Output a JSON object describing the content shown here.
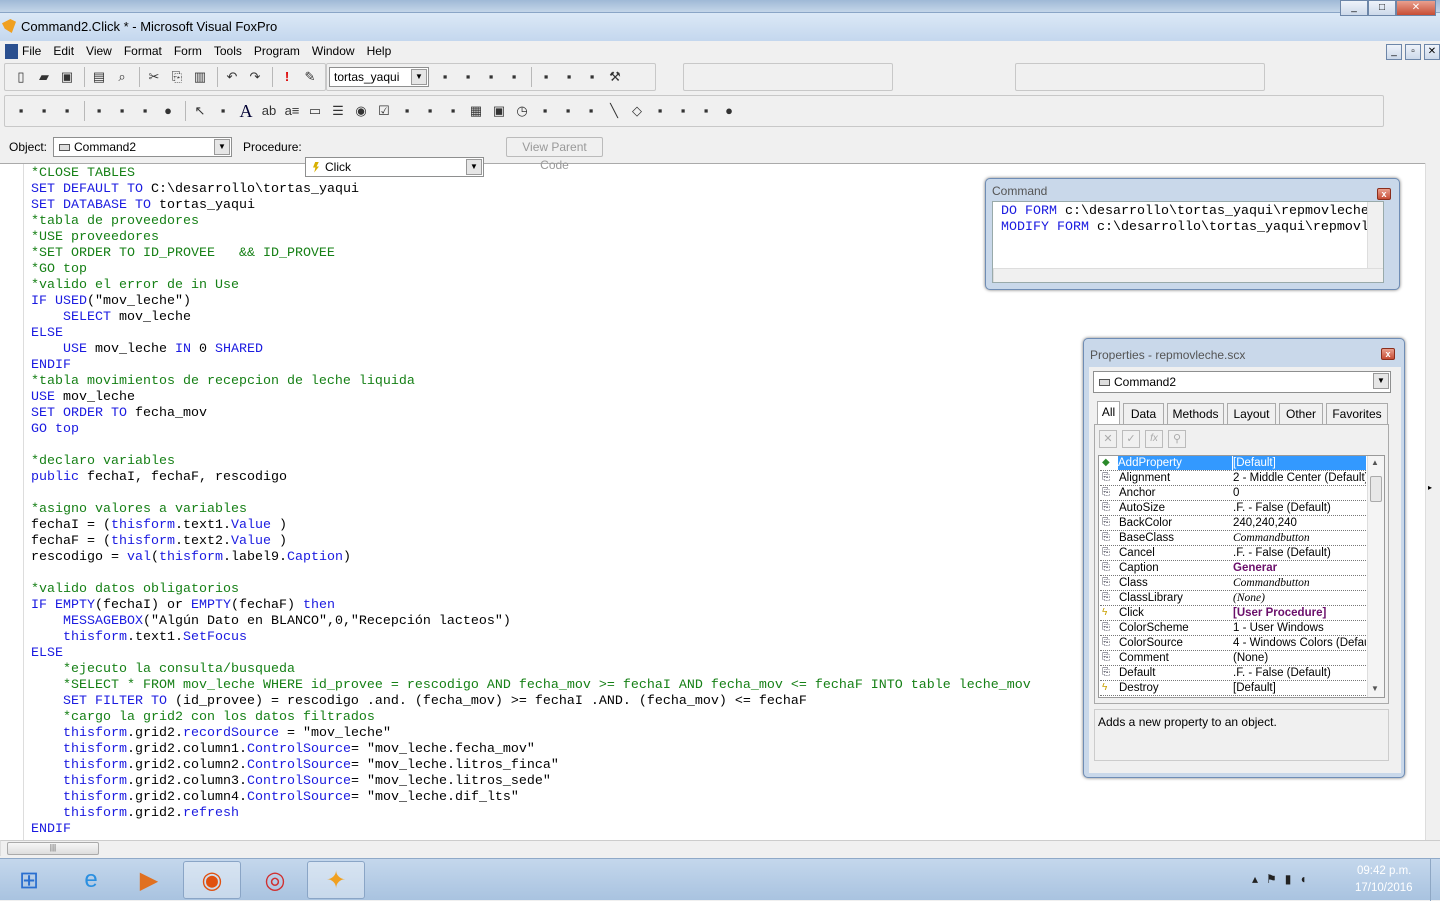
{
  "window": {
    "title": "Command2.Click * - Microsoft Visual FoxPro",
    "controls": [
      "_",
      "□",
      "✕"
    ],
    "mdi_controls": [
      "_",
      "▫",
      "✕"
    ]
  },
  "menu": [
    "File",
    "Edit",
    "View",
    "Format",
    "Form",
    "Tools",
    "Program",
    "Window",
    "Help"
  ],
  "toolbar": {
    "database_combo": "tortas_yaqui",
    "row1_icons": [
      "new-icon",
      "open-icon",
      "save-icon",
      "|",
      "print-icon",
      "print-preview-icon",
      "|",
      "cut-icon",
      "copy-icon",
      "paste-icon",
      "|",
      "undo-icon",
      "redo-icon",
      "|",
      "run-icon",
      "modify-form-icon"
    ],
    "row1b_icons": [
      "data-session-icon",
      "database-icon",
      "properties-icon",
      "code-window-icon",
      "|",
      "form-builder-icon",
      "autoformat-icon",
      "tab-order-icon",
      "tools-icon"
    ],
    "row2_icons": [
      "builder-lock-icon",
      "layout-icon",
      "grid-icon",
      "|",
      "builder-icon",
      "autoformat2-icon",
      "align-icon",
      "lock-icon",
      "|",
      "pointer-icon",
      "view-classes-icon",
      "label-icon",
      "textbox-icon",
      "editbox-icon",
      "commandbutton-icon",
      "commandgroup-icon",
      "optiongroup-icon",
      "checkbox-icon",
      "combobox-icon",
      "listbox-icon",
      "spinner-icon",
      "grid-control-icon",
      "image-icon",
      "timer-icon",
      "pageframe-icon",
      "ole-container-icon",
      "ole-bound-icon",
      "line-icon",
      "shape-icon",
      "container-icon",
      "separator-icon",
      "hyperlink-icon",
      "button-lock-icon"
    ]
  },
  "object_bar": {
    "object_label": "Object:",
    "object_value": "Command2",
    "procedure_label": "Procedure:",
    "procedure_value": "Click",
    "view_parent_label": "View Parent Code"
  },
  "code_lines": [
    [
      [
        "c",
        "*CLOSE TABLES"
      ]
    ],
    [
      [
        "k",
        "SET DEFAULT TO "
      ],
      [
        "x",
        "C:\\desarrollo\\tortas_yaqui"
      ]
    ],
    [
      [
        "k",
        "SET DATABASE TO "
      ],
      [
        "x",
        "tortas_yaqui"
      ]
    ],
    [
      [
        "c",
        "*tabla de proveedores"
      ]
    ],
    [
      [
        "c",
        "*USE proveedores"
      ]
    ],
    [
      [
        "c",
        "*SET ORDER TO ID_PROVEE   && ID_PROVEE"
      ]
    ],
    [
      [
        "c",
        "*GO top"
      ]
    ],
    [
      [
        "c",
        "*valido el error de in Use"
      ]
    ],
    [
      [
        "k",
        "IF USED"
      ],
      [
        "x",
        "(\"mov_leche\")"
      ]
    ],
    [
      [
        "k",
        "    SELECT "
      ],
      [
        "x",
        "mov_leche"
      ]
    ],
    [
      [
        "k",
        "ELSE"
      ]
    ],
    [
      [
        "k",
        "    USE "
      ],
      [
        "x",
        "mov_leche "
      ],
      [
        "k",
        "IN "
      ],
      [
        "x",
        "0 "
      ],
      [
        "k",
        "SHARED"
      ]
    ],
    [
      [
        "k",
        "ENDIF"
      ]
    ],
    [
      [
        "c",
        "*tabla movimientos de recepcion de leche liquida"
      ]
    ],
    [
      [
        "k",
        "USE "
      ],
      [
        "x",
        "mov_leche"
      ]
    ],
    [
      [
        "k",
        "SET ORDER TO "
      ],
      [
        "x",
        "fecha_mov"
      ]
    ],
    [
      [
        "k",
        "GO top"
      ]
    ],
    [],
    [
      [
        "c",
        "*declaro variables"
      ]
    ],
    [
      [
        "k",
        "public "
      ],
      [
        "x",
        "fechaI, fechaF, rescodigo"
      ]
    ],
    [],
    [
      [
        "c",
        "*asigno valores a variables"
      ]
    ],
    [
      [
        "x",
        "fechaI = ("
      ],
      [
        "k",
        "thisform"
      ],
      [
        "x",
        ".text1."
      ],
      [
        "k",
        "Value"
      ],
      [
        "x",
        " )"
      ]
    ],
    [
      [
        "x",
        "fechaF = ("
      ],
      [
        "k",
        "thisform"
      ],
      [
        "x",
        ".text2."
      ],
      [
        "k",
        "Value"
      ],
      [
        "x",
        " )"
      ]
    ],
    [
      [
        "x",
        "rescodigo = "
      ],
      [
        "k",
        "val"
      ],
      [
        "x",
        "("
      ],
      [
        "k",
        "thisform"
      ],
      [
        "x",
        ".label9."
      ],
      [
        "k",
        "Caption"
      ],
      [
        "x",
        ")"
      ]
    ],
    [],
    [
      [
        "c",
        "*valido datos obligatorios"
      ]
    ],
    [
      [
        "k",
        "IF EMPTY"
      ],
      [
        "x",
        "(fechaI) or "
      ],
      [
        "k",
        "EMPTY"
      ],
      [
        "x",
        "(fechaF) "
      ],
      [
        "k",
        "then"
      ]
    ],
    [
      [
        "k",
        "    MESSAGEBOX"
      ],
      [
        "x",
        "(\"Algún Dato en BLANCO\",0,\"Recepción lacteos\")"
      ]
    ],
    [
      [
        "x",
        "    "
      ],
      [
        "k",
        "thisform"
      ],
      [
        "x",
        ".text1."
      ],
      [
        "k",
        "SetFocus"
      ]
    ],
    [
      [
        "k",
        "ELSE"
      ]
    ],
    [
      [
        "c",
        "    *ejecuto la consulta/busqueda"
      ]
    ],
    [
      [
        "c",
        "    *SELECT * FROM mov_leche WHERE id_provee = rescodigo AND fecha_mov >= fechaI AND fecha_mov <= fechaF INTO table leche_mov"
      ]
    ],
    [
      [
        "k",
        "    SET FILTER TO "
      ],
      [
        "x",
        "(id_provee) = rescodigo .and. (fecha_mov) >= fechaI .AND. (fecha_mov) <= fechaF"
      ]
    ],
    [
      [
        "c",
        "    *cargo la grid2 con los datos filtrados"
      ]
    ],
    [
      [
        "x",
        "    "
      ],
      [
        "k",
        "thisform"
      ],
      [
        "x",
        ".grid2."
      ],
      [
        "k",
        "recordSource"
      ],
      [
        "x",
        " = \"mov_leche\""
      ]
    ],
    [
      [
        "x",
        "    "
      ],
      [
        "k",
        "thisform"
      ],
      [
        "x",
        ".grid2.column1."
      ],
      [
        "k",
        "ControlSource"
      ],
      [
        "x",
        "= \"mov_leche.fecha_mov\""
      ]
    ],
    [
      [
        "x",
        "    "
      ],
      [
        "k",
        "thisform"
      ],
      [
        "x",
        ".grid2.column2."
      ],
      [
        "k",
        "ControlSource"
      ],
      [
        "x",
        "= \"mov_leche.litros_finca\""
      ]
    ],
    [
      [
        "x",
        "    "
      ],
      [
        "k",
        "thisform"
      ],
      [
        "x",
        ".grid2.column3."
      ],
      [
        "k",
        "ControlSource"
      ],
      [
        "x",
        "= \"mov_leche.litros_sede\""
      ]
    ],
    [
      [
        "x",
        "    "
      ],
      [
        "k",
        "thisform"
      ],
      [
        "x",
        ".grid2.column4."
      ],
      [
        "k",
        "ControlSource"
      ],
      [
        "x",
        "= \"mov_leche.dif_lts\""
      ]
    ],
    [
      [
        "x",
        "    "
      ],
      [
        "k",
        "thisform"
      ],
      [
        "x",
        ".grid2."
      ],
      [
        "k",
        "refresh"
      ]
    ],
    [
      [
        "k",
        "ENDIF"
      ]
    ]
  ],
  "command_window": {
    "title": "Command",
    "lines": [
      [
        [
          "k",
          "DO FORM "
        ],
        [
          "x",
          "c:\\desarrollo\\tortas_yaqui\\repmovleche."
        ]
      ],
      [
        [
          "k",
          "MODIFY FORM "
        ],
        [
          "x",
          "c:\\desarrollo\\tortas_yaqui\\repmovle"
        ]
      ]
    ]
  },
  "properties": {
    "title": "Properties - repmovleche.scx",
    "object": "Command2",
    "tabs": [
      "All",
      "Data",
      "Methods",
      "Layout",
      "Other",
      "Favorites"
    ],
    "active_tab": "All",
    "rows": [
      {
        "name": "AddProperty",
        "value": "[Default]",
        "icon": "method-icon",
        "selected": true
      },
      {
        "name": "Alignment",
        "value": "2 - Middle Center (Default)",
        "icon": "property-icon"
      },
      {
        "name": "Anchor",
        "value": "0",
        "icon": "property-icon"
      },
      {
        "name": "AutoSize",
        "value": ".F. - False (Default)",
        "icon": "property-icon"
      },
      {
        "name": "BackColor",
        "value": "240,240,240",
        "icon": "property-icon"
      },
      {
        "name": "BaseClass",
        "value": "Commandbutton",
        "icon": "property-icon",
        "style": "italic"
      },
      {
        "name": "Cancel",
        "value": ".F. - False (Default)",
        "icon": "property-icon"
      },
      {
        "name": "Caption",
        "value": "Generar",
        "icon": "property-icon",
        "style": "bold"
      },
      {
        "name": "Class",
        "value": "Commandbutton",
        "icon": "property-icon",
        "style": "italic"
      },
      {
        "name": "ClassLibrary",
        "value": "(None)",
        "icon": "property-icon",
        "style": "italic"
      },
      {
        "name": "Click",
        "value": "[User Procedure]",
        "icon": "event-icon",
        "style": "bold"
      },
      {
        "name": "ColorScheme",
        "value": "1 - User Windows",
        "icon": "property-icon"
      },
      {
        "name": "ColorSource",
        "value": "4 - Windows Colors (Default)",
        "icon": "property-icon"
      },
      {
        "name": "Comment",
        "value": "(None)",
        "icon": "property-icon"
      },
      {
        "name": "Default",
        "value": ".F. - False (Default)",
        "icon": "property-icon"
      },
      {
        "name": "Destroy",
        "value": "[Default]",
        "icon": "event-icon"
      }
    ],
    "description": "Adds a new property to an object."
  },
  "taskbar": {
    "apps": [
      "start-icon",
      "internet-explorer-icon",
      "media-player-icon",
      "firefox-icon",
      "chrome-icon",
      "visual-foxpro-icon"
    ],
    "time": "09:42 p.m.",
    "date": "17/10/2016"
  },
  "colors": {
    "keyword": "#1a1ae0",
    "comment": "#168016",
    "selection": "#3399ff",
    "modified_value": "#6a0f6a"
  }
}
